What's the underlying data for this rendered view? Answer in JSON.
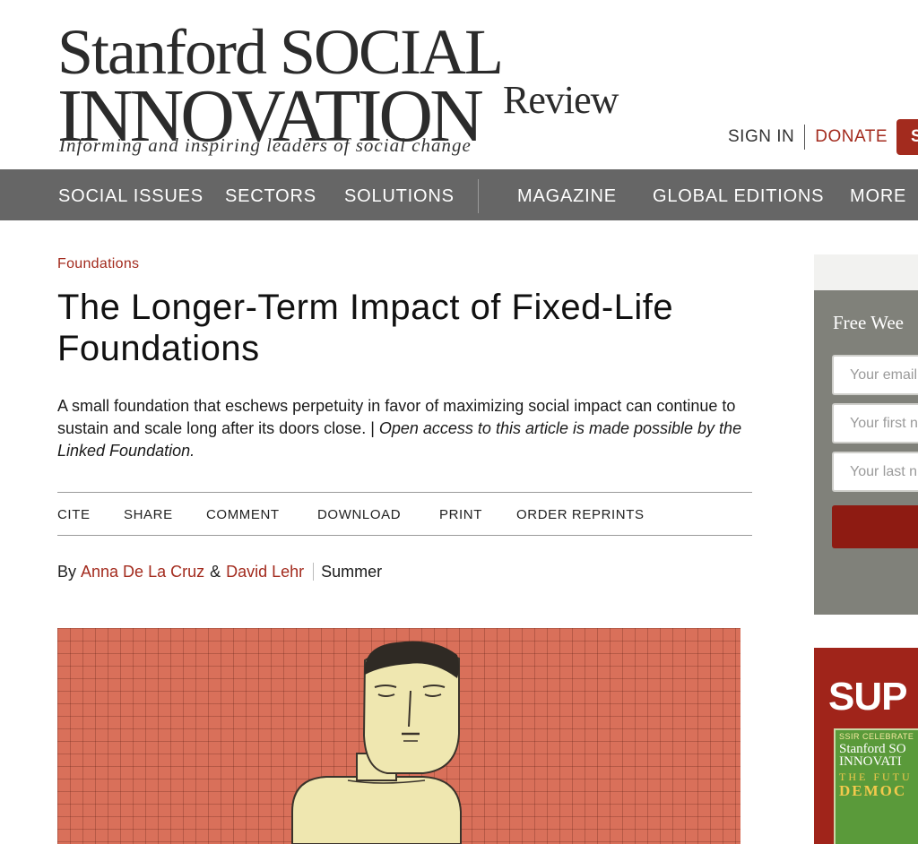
{
  "header": {
    "logo": {
      "line1": "Stanford SOCIAL",
      "line2": "INNOVATION",
      "review": "Review",
      "tagline": "Informing and inspiring leaders of social change"
    },
    "sign_in": "SIGN IN",
    "donate": "DONATE",
    "subscribe": "SU"
  },
  "nav": {
    "items": [
      "SOCIAL ISSUES",
      "SECTORS",
      "SOLUTIONS",
      "MAGAZINE",
      "GLOBAL EDITIONS",
      "MORE"
    ]
  },
  "article": {
    "category": "Foundations",
    "title": "The Longer-Term Impact of Fixed-Life Foundations",
    "dek": "A small foundation that eschews perpetuity in favor of maximizing social impact can continue to sustain and scale long after its doors close. | ",
    "dek_italic": "Open access to this article is made possible by the Linked Foundation.",
    "actions": [
      "CITE",
      "SHARE",
      "COMMENT",
      "DOWNLOAD",
      "PRINT",
      "ORDER REPRINTS"
    ],
    "byline": {
      "by": "By",
      "author1": "Anna De La Cruz",
      "amp": "&",
      "author2": "David Lehr",
      "issue": "Summer"
    }
  },
  "sidebar": {
    "newsletter": {
      "title": "Free Wee",
      "email_placeholder": "Your email",
      "first_placeholder": "Your first n",
      "last_placeholder": "Your last n"
    },
    "promo": {
      "title": "SUP",
      "cover_kicker": "SSIR CELEBRATE",
      "cover_logo_line1": "Stanford SO",
      "cover_logo_line2": "INNOVATI",
      "cover_head": "THE FUTU",
      "cover_head2": "DEMOC"
    }
  },
  "colors": {
    "accent": "#a32b1e",
    "nav_bg": "#666666",
    "newsletter_bg": "#80817a",
    "hero_bg": "#d9705a"
  }
}
